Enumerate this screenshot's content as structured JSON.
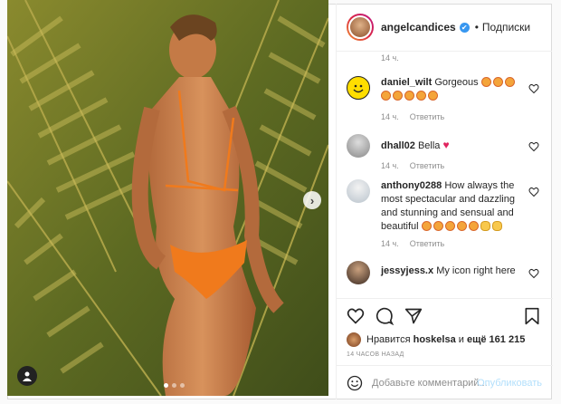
{
  "header": {
    "username": "angelcandices",
    "verified_mark": "✔",
    "follow_label": "Подписки",
    "separator": "•"
  },
  "comments": {
    "top_time": "14 ч.",
    "items": [
      {
        "user": "daniel_wilt",
        "text": "Gorgeous",
        "time": "14 ч.",
        "reply": "Ответить"
      },
      {
        "user": "dhall02",
        "text": "Bella",
        "time": "14 ч.",
        "reply": "Ответить"
      },
      {
        "user": "anthony0288",
        "text": "How always the most spectacular and dazzling and stunning and sensual and beautiful",
        "time": "14 ч.",
        "reply": "Ответить"
      },
      {
        "user": "jessyjess.x",
        "text": "My icon right here",
        "time": "",
        "reply": ""
      }
    ]
  },
  "likes": {
    "prefix": "Нравится",
    "user": "hoskelsa",
    "mid": "и",
    "count": "ещё 161 215"
  },
  "date": "14 ЧАСОВ НАЗАД",
  "add_comment": {
    "placeholder": "Добавьте комментарий...",
    "post_label": "Опубликовать"
  },
  "icons": [
    "heart-icon",
    "comment-icon",
    "share-icon",
    "bookmark-icon",
    "emoji-icon",
    "user-tag-icon",
    "chevron-right-icon"
  ],
  "colors": {
    "accent": "#3897f0",
    "post_disabled": "#b2dffc",
    "bikini": "#f07a1c"
  }
}
